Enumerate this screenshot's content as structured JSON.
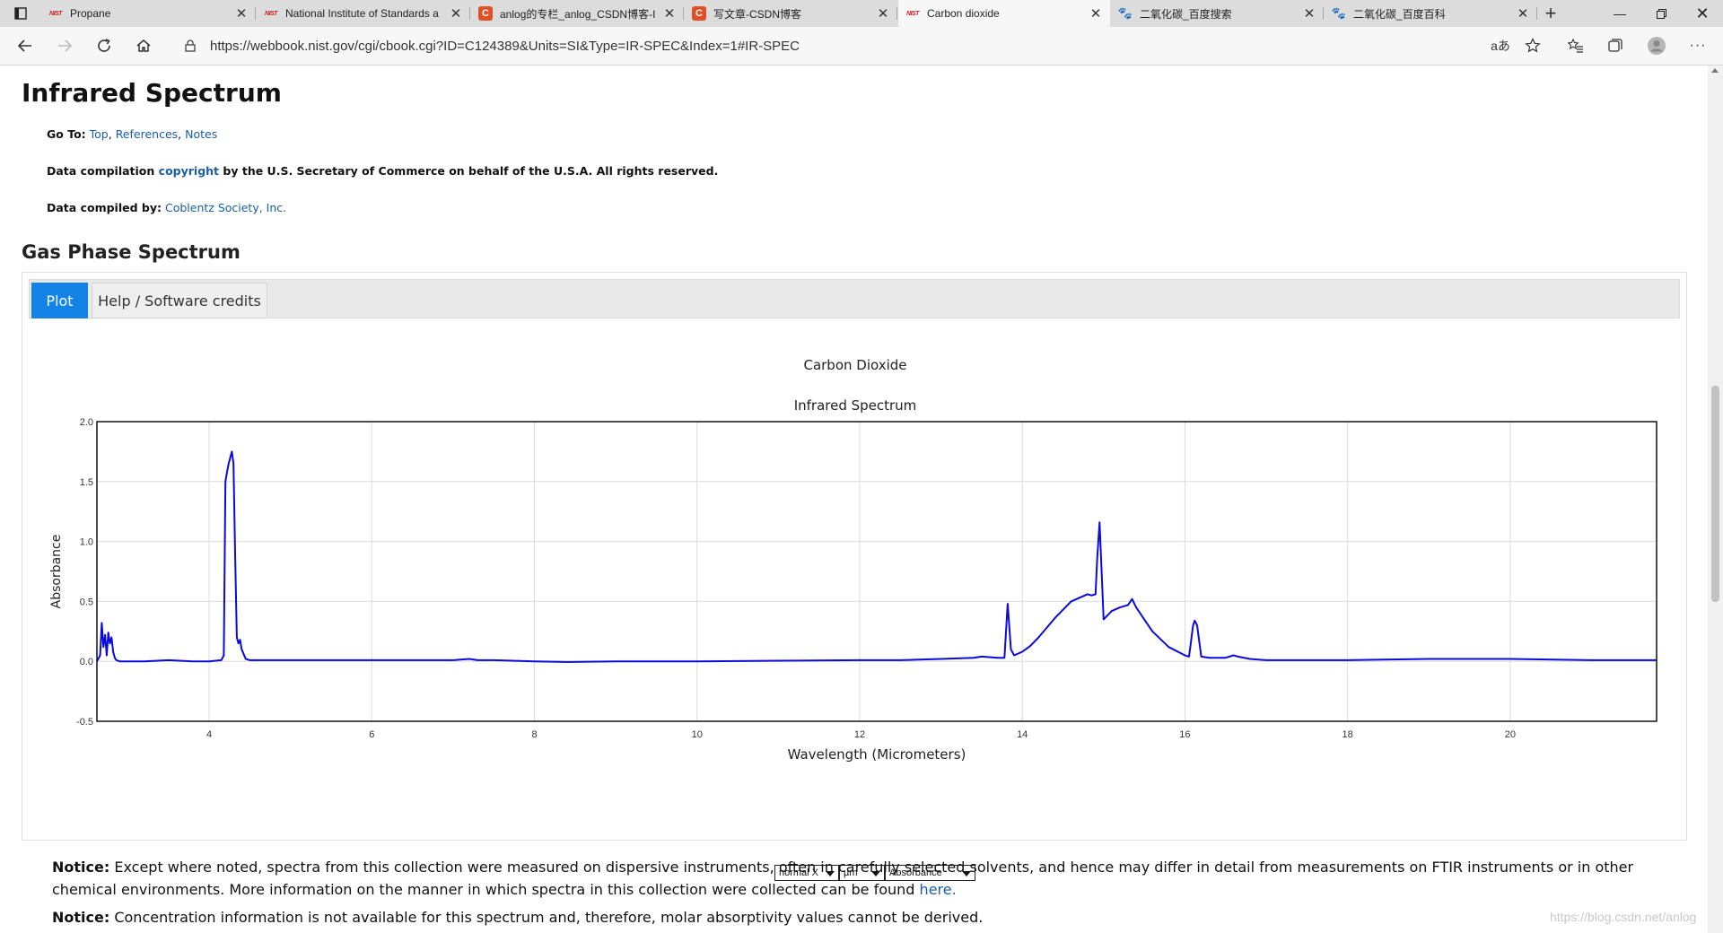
{
  "browser": {
    "tabs": [
      {
        "title": "Propane",
        "favicon": "nist",
        "active": false
      },
      {
        "title": "National Institute of Standards a",
        "favicon": "nist",
        "active": false
      },
      {
        "title": "anlog的专栏_anlog_CSDN博客-I",
        "favicon": "csdn",
        "active": false
      },
      {
        "title": "写文章-CSDN博客",
        "favicon": "csdn",
        "active": false
      },
      {
        "title": "Carbon dioxide",
        "favicon": "nist",
        "active": true
      },
      {
        "title": "二氧化碳_百度搜索",
        "favicon": "baidu",
        "active": false
      },
      {
        "title": "二氧化碳_百度百科",
        "favicon": "baidu",
        "active": false
      }
    ],
    "favicon_text": {
      "nist": "NIST",
      "csdn": "C",
      "baidu": "🐾"
    },
    "url": "https://webbook.nist.gov/cgi/cbook.cgi?ID=C124389&Units=SI&Type=IR-SPEC&Index=1#IR-SPEC",
    "read_aloud_label": "aあ"
  },
  "page": {
    "title": "Infrared Spectrum",
    "goto_label": "Go To:",
    "goto_links": [
      "Top",
      "References",
      "Notes"
    ],
    "compilation_prefix": "Data compilation",
    "compilation_link": "copyright",
    "compilation_suffix": "by the U.S. Secretary of Commerce on behalf of the U.S.A. All rights reserved.",
    "compiled_by_label": "Data compiled by:",
    "compiled_by_link": "Coblentz Society, Inc.",
    "section_title": "Gas Phase Spectrum",
    "tabs": [
      "Plot",
      "Help / Software credits"
    ],
    "selects": [
      "normal X",
      "µm",
      "Absorbance"
    ],
    "notice1_label": "Notice:",
    "notice1_text": "Except where noted, spectra from this collection were measured on dispersive instruments, often in carefully selected solvents, and hence may differ in detail from measurements on FTIR instruments or in other chemical environments. More information on the manner in which spectra in this collection were collected can be found",
    "notice1_link": "here.",
    "notice2_label": "Notice:",
    "notice2_text": "Concentration information is not available for this spectrum and, therefore, molar absorptivity values cannot be derived.",
    "watermark": "https://blog.csdn.net/anlog"
  },
  "chart_data": {
    "type": "line",
    "title": "Carbon Dioxide",
    "subtitle": "Infrared Spectrum",
    "xlabel": "Wavelength (Micrometers)",
    "ylabel": "Absorbance",
    "xlim": [
      2.62,
      21.8
    ],
    "ylim": [
      -0.5,
      2.0
    ],
    "xticks": [
      4,
      6,
      8,
      10,
      12,
      14,
      16,
      18,
      20
    ],
    "yticks": [
      -0.5,
      0.0,
      0.5,
      1.0,
      1.5,
      2.0
    ],
    "ytick_labels": [
      "-0.5",
      "0.0",
      "0.5",
      "1.0",
      "1.5",
      "2.0"
    ],
    "grid": true,
    "line_color": "#0a0adc",
    "series": [
      {
        "x": [
          2.62,
          2.66,
          2.68,
          2.7,
          2.72,
          2.74,
          2.76,
          2.78,
          2.8,
          2.82,
          2.84,
          2.86,
          2.9,
          3.0,
          3.2,
          3.5,
          3.8,
          4.0,
          4.15,
          4.18,
          4.2,
          4.22,
          4.24,
          4.26,
          4.28,
          4.3,
          4.32,
          4.34,
          4.36,
          4.38,
          4.4,
          4.45,
          4.5,
          5.0,
          6.0,
          7.0,
          7.2,
          7.3,
          7.5,
          8.0,
          8.4,
          9.0,
          10.0,
          11.0,
          12.0,
          12.5,
          13.0,
          13.4,
          13.5,
          13.7,
          13.78,
          13.82,
          13.86,
          13.9,
          14.0,
          14.1,
          14.2,
          14.4,
          14.6,
          14.8,
          14.85,
          14.9,
          14.92,
          14.95,
          15.0,
          15.1,
          15.2,
          15.3,
          15.35,
          15.4,
          15.5,
          15.6,
          15.8,
          16.0,
          16.05,
          16.1,
          16.12,
          16.15,
          16.2,
          16.3,
          16.5,
          16.6,
          16.65,
          16.8,
          17.0,
          18.0,
          19.0,
          20.0,
          21.0,
          21.8
        ],
        "y": [
          0.0,
          0.05,
          0.32,
          0.12,
          0.22,
          0.05,
          0.24,
          0.15,
          0.2,
          0.08,
          0.03,
          0.01,
          0.0,
          0.0,
          0.0,
          0.01,
          0.0,
          0.0,
          0.01,
          0.05,
          1.5,
          1.58,
          1.65,
          1.7,
          1.75,
          1.65,
          0.9,
          0.2,
          0.15,
          0.18,
          0.1,
          0.02,
          0.01,
          0.01,
          0.01,
          0.01,
          0.02,
          0.01,
          0.01,
          0.0,
          -0.005,
          0.0,
          0.0,
          0.005,
          0.01,
          0.01,
          0.02,
          0.03,
          0.04,
          0.03,
          0.03,
          0.48,
          0.1,
          0.05,
          0.08,
          0.13,
          0.2,
          0.36,
          0.5,
          0.56,
          0.55,
          0.56,
          0.85,
          1.16,
          0.35,
          0.42,
          0.45,
          0.47,
          0.52,
          0.45,
          0.35,
          0.25,
          0.12,
          0.05,
          0.04,
          0.3,
          0.34,
          0.3,
          0.04,
          0.03,
          0.03,
          0.05,
          0.04,
          0.02,
          0.01,
          0.01,
          0.02,
          0.02,
          0.01,
          0.01
        ]
      }
    ]
  }
}
